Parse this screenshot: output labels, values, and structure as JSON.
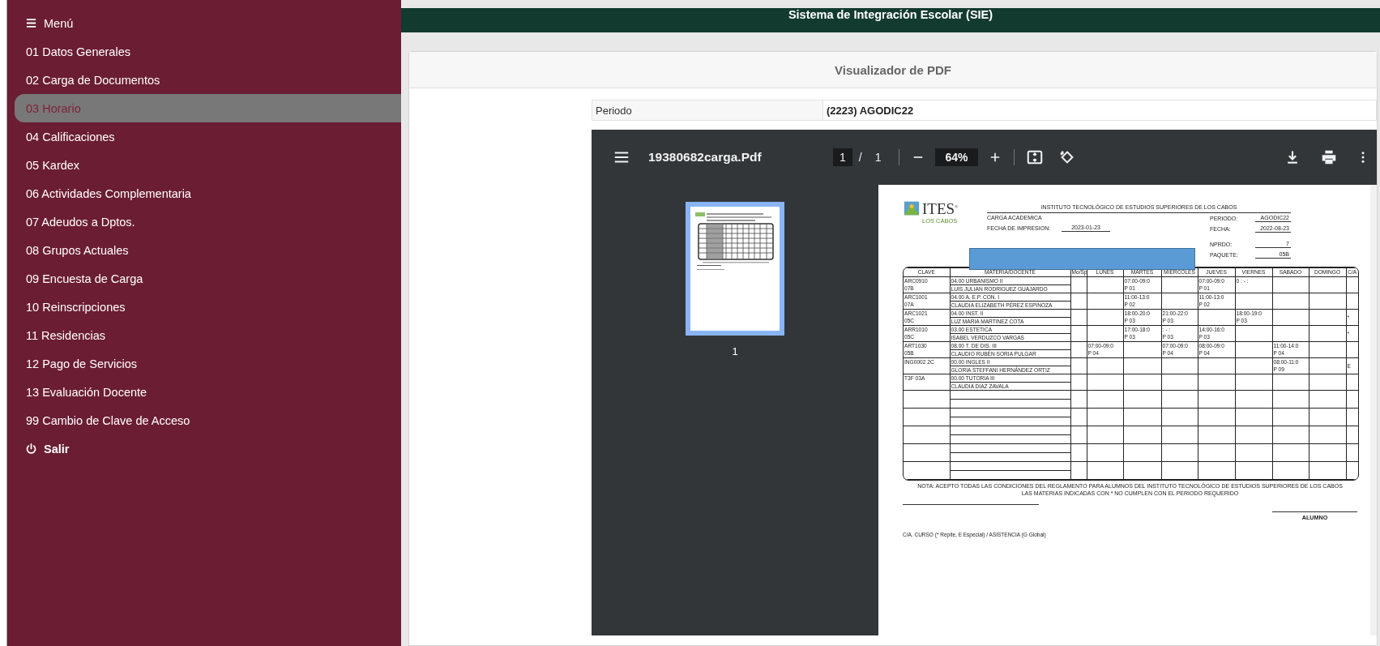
{
  "header": {
    "title": "Sistema de Integración Escolar (SIE)"
  },
  "sidebar": {
    "menu_label": "Menú",
    "items": [
      {
        "label": "01 Datos Generales",
        "selected": false
      },
      {
        "label": "02 Carga de Documentos",
        "selected": false
      },
      {
        "label": "03 Horario",
        "selected": true
      },
      {
        "label": "04 Calificaciones",
        "selected": false
      },
      {
        "label": "05 Kardex",
        "selected": false
      },
      {
        "label": "06 Actividades Complementaria",
        "selected": false
      },
      {
        "label": "07 Adeudos a Dptos.",
        "selected": false
      },
      {
        "label": "08 Grupos Actuales",
        "selected": false
      },
      {
        "label": "09 Encuesta de Carga",
        "selected": false
      },
      {
        "label": "10 Reinscripciones",
        "selected": false
      },
      {
        "label": "11 Residencias",
        "selected": false
      },
      {
        "label": "12 Pago de Servicios",
        "selected": false
      },
      {
        "label": "13 Evaluación Docente",
        "selected": false
      },
      {
        "label": "99 Cambio de Clave de Acceso",
        "selected": false
      }
    ],
    "logout_label": "Salir"
  },
  "card": {
    "title": "Visualizador de PDF"
  },
  "period": {
    "label": "Periodo",
    "value": "(2223) AGODIC22"
  },
  "pdf_viewer": {
    "file_name": "19380682carga.Pdf",
    "page": "1",
    "page_separator": "/",
    "page_count": "1",
    "zoom": "64%",
    "thumbnail_label": "1",
    "document": {
      "logo_text": "ITES$^{®}$",
      "logo_subtext": "LOS CABOS",
      "institution": "INSTITUTO TECNOLÓGICO DE ESTUDIOS SUPERIORES DE LOS CABOS",
      "doc_title": "CARGA ACADEMICA",
      "fields": [
        {
          "label": "FECHA DE IMPRESION:",
          "value": "2023-01-23"
        },
        {
          "label": "PERIODO:",
          "value": "AGODIC22"
        },
        {
          "label": "FECHA:",
          "value": "2022-08-23"
        },
        {
          "label": "NPRDO:",
          "value": "7"
        },
        {
          "label": "PAQUETE:",
          "value": "05B"
        }
      ],
      "columns": [
        "CLAVE",
        "MATERIA/DOCENTE",
        "Mo/Sp",
        "LUNES",
        "MARTES",
        "MIERCOLES",
        "JUEVES",
        "VIERNES",
        "SABADO",
        "DOMINGO",
        "C/A"
      ],
      "courses": [
        {
          "clave": "ARC0910",
          "group": "07B",
          "subject": "04.00 URBANISMO II",
          "teacher": "LUIS JULIAN RODRIGUEZ GUAJARDO",
          "schedule": {
            "martes": {
              "time": "07:00-09:0",
              "room": "P 01"
            },
            "jueves": {
              "time": "07:00-09:0",
              "room": "P 01"
            },
            "viernes": {
              "time": "0 : - :"
            }
          }
        },
        {
          "clave": "ARC1001",
          "group": "07A",
          "subject": "04.00 A. E.P. CON. I",
          "teacher": "CLAUDIA ELIZABETH PÉREZ ESPINOZA",
          "schedule": {
            "martes": {
              "time": "11:00-13:0",
              "room": "P 02"
            },
            "jueves": {
              "time": "11:00-13:0",
              "room": "P 02"
            }
          }
        },
        {
          "clave": "ARC1021",
          "group": "05C",
          "subject": "04.00 INST. II",
          "teacher": "LUZ MARIA MARTINEZ COTA",
          "schedule": {
            "martes": {
              "time": "18:00-20:0",
              "room": "P 03"
            },
            "miercoles": {
              "time": "21:00-22:0",
              "room": "P 03"
            },
            "viernes": {
              "time": "18:00-19:0",
              "room": "P 03"
            }
          },
          "ca": "*"
        },
        {
          "clave": "ARR1010",
          "group": "05C",
          "subject": "03.00 ESTETICA",
          "teacher": "ISABEL VERDUZCO VARGAS",
          "schedule": {
            "martes": {
              "time": "17:00-18:0",
              "room": "P 03"
            },
            "miercoles": {
              "time": ": - :",
              "room": "P 03"
            },
            "jueves": {
              "time": "14:00-16:0",
              "room": "P 03"
            }
          },
          "ca": "*"
        },
        {
          "clave": "ART1030",
          "group": "05B",
          "subject": "08.00 T. DE DIS. III",
          "teacher": "CLAUDIO RUBÉN SORIA PULGAR",
          "schedule": {
            "lunes": {
              "time": "07:00-09:0",
              "room": "P 04"
            },
            "miercoles": {
              "time": "07:00-09:0",
              "room": "P 04"
            },
            "jueves": {
              "time": "08:00-09:0",
              "room": "P 04"
            },
            "sabado": {
              "time": "11:00-14:0",
              "room": "P 04"
            }
          }
        },
        {
          "clave": "ING0002   2C",
          "subject": "00.00 INGLES II",
          "teacher": "GLORIA STEFFANI HERNÁNDEZ ORTIZ",
          "schedule": {
            "sabado": {
              "time": "08:00-11:0",
              "room": "P 09"
            }
          },
          "ca": "E"
        },
        {
          "clave": "T3F      03A",
          "subject": "00.00 TUTORIA III",
          "teacher": "CLAUDIA DIAZ ZAVALA"
        }
      ],
      "notes": [
        "NOTA: ACEPTO TODAS LAS CONDICIONES DEL REGLAMENTO PARA ALUMNOS DEL INSTITUTO TECNOLÓGICO DE ESTUDIOS SUPERIORES DE LOS CABOS",
        "LAS MATERIAS INDICADAS CON * NO CUMPLEN CON EL PERIODO REQUERIDO"
      ],
      "signature_label": "ALUMNO",
      "legend": "C/A. CURSO (* Repite, E Especial) / ASISTENCIA (G Global)"
    }
  }
}
